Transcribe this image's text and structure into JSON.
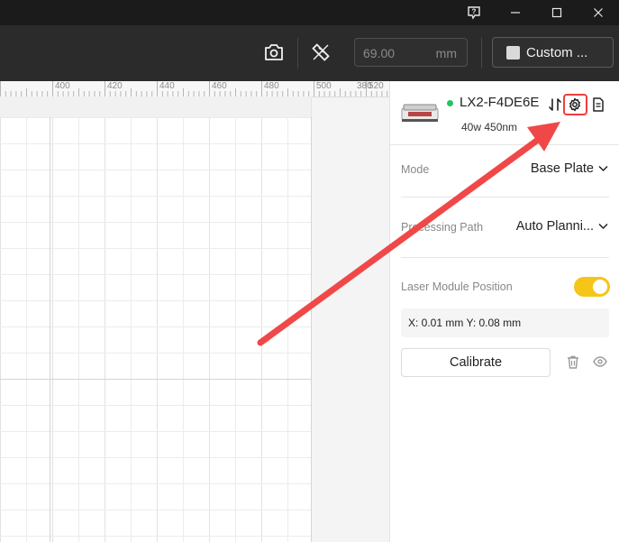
{
  "toolbar": {
    "dimension_value": "69.00",
    "dimension_unit": "mm",
    "custom_label": "Custom ..."
  },
  "ruler": {
    "labels": [
      "380",
      "400",
      "420",
      "440",
      "460",
      "480",
      "500",
      "520"
    ]
  },
  "device": {
    "name": "LX2-F4DE6E",
    "spec": "40w 450nm",
    "status_color": "#22c55e"
  },
  "settings": {
    "mode_label": "Mode",
    "mode_value": "Base Plate",
    "path_label": "Processing Path",
    "path_value": "Auto Planni...",
    "laser_label": "Laser Module Position",
    "laser_enabled": true,
    "coords": "X: 0.01 mm   Y: 0.08 mm",
    "calibrate_label": "Calibrate"
  },
  "colors": {
    "toggle_on": "#f5c518",
    "highlight": "#f03e3e",
    "annotation_arrow": "#f04848"
  }
}
